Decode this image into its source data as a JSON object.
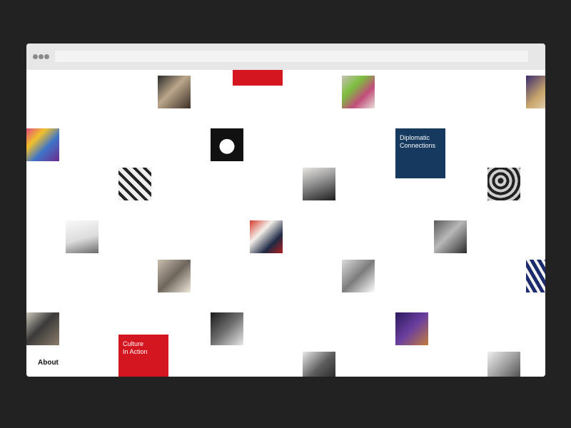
{
  "window": {
    "chrome_buttons": [
      "dot",
      "dot",
      "dot"
    ],
    "url_bar": ""
  },
  "cards": {
    "diplomatic": {
      "label_line1": "Diplomatic",
      "label_line2": "Connections",
      "color": "#163a5f"
    },
    "culture": {
      "label_line1": "Culture",
      "label_line2": "In Action",
      "color": "#d3161f"
    },
    "top_red": {
      "color": "#d3161f"
    }
  },
  "nav": {
    "about_label": "About"
  },
  "tiles": [
    {
      "name": "photo-hands-craft",
      "bg": "linear-gradient(135deg,#2a2a2a 0%,#bba68a 45%,#3b2f26 100%)"
    },
    {
      "name": "photo-colorful-art-top",
      "bg": "linear-gradient(135deg,#c8c1b6 0%,#7cbe3e 35%,#c24d7b 65%,#e7e1d9 100%)"
    },
    {
      "name": "photo-purple-edge-top",
      "bg": "linear-gradient(135deg,#3b2d6e 0%,#c9a66b 50%,#f2e7d8 100%)"
    },
    {
      "name": "photo-rainbow-fabric",
      "bg": "linear-gradient(135deg,#e04a7d 0%,#f2c12b 30%,#3e74c8 60%,#6e2a8c 100%)"
    },
    {
      "name": "photo-cartoon-mouse",
      "bg": "radial-gradient(circle at 50% 55%,#fff 0 30%,#111 31% 100%)"
    },
    {
      "name": "photo-ceramic-shoes",
      "bg": "repeating-linear-gradient(45deg,#eee 0 6px,#222 6px 10px)"
    },
    {
      "name": "photo-woman-portrait",
      "bg": "linear-gradient(160deg,#e9e6e1 0%,#9a9a9a 40%,#1d1d1d 100%)"
    },
    {
      "name": "photo-spirals",
      "bg": "repeating-radial-gradient(circle at 40% 40%,#222 0 4px,#cfcfcf 4px 8px)"
    },
    {
      "name": "photo-gemini-sign",
      "bg": "linear-gradient(165deg,#fafafa 0%,#dcdcdc 55%,#6b6b6b 100%)"
    },
    {
      "name": "photo-signing-ceremony",
      "bg": "linear-gradient(135deg,#d43a2f 0%,#f4f0ea 35%,#1e2a44 70%,#b21e1e 100%)"
    },
    {
      "name": "photo-people-gathering",
      "bg": "linear-gradient(135deg,#5a5a5a 0%,#b8b8b8 45%,#2b2b2b 100%)"
    },
    {
      "name": "photo-children",
      "bg": "linear-gradient(135deg,#cbbfae 0%,#6e655c 50%,#f1e9dc 100%)"
    },
    {
      "name": "photo-woman-desk",
      "bg": "linear-gradient(135deg,#dcdcdc 0%,#7c7c7c 50%,#ffffff 100%)"
    },
    {
      "name": "photo-blue-pattern",
      "bg": "repeating-linear-gradient(60deg,#1b2b6b 0 5px,#f2f2f2 5px 9px)"
    },
    {
      "name": "photo-soldiers",
      "bg": "linear-gradient(135deg,#cfc7bb 0%,#3a3a3a 45%,#8c7d6b 100%)"
    },
    {
      "name": "photo-classroom",
      "bg": "linear-gradient(135deg,#1a1a1a 0%,#707070 50%,#e8e8e8 100%)"
    },
    {
      "name": "photo-purple-people",
      "bg": "linear-gradient(135deg,#2d1a5c 0%,#6b3fa0 50%,#c27d3c 100%)"
    },
    {
      "name": "photo-boxing",
      "bg": "linear-gradient(135deg,#eaeaea 0%,#5c5c5c 50%,#1e1e1e 100%)"
    },
    {
      "name": "photo-men-group",
      "bg": "linear-gradient(135deg,#f0f0f0 0%,#9b9b9b 50%,#3b3b3b 100%)"
    }
  ]
}
